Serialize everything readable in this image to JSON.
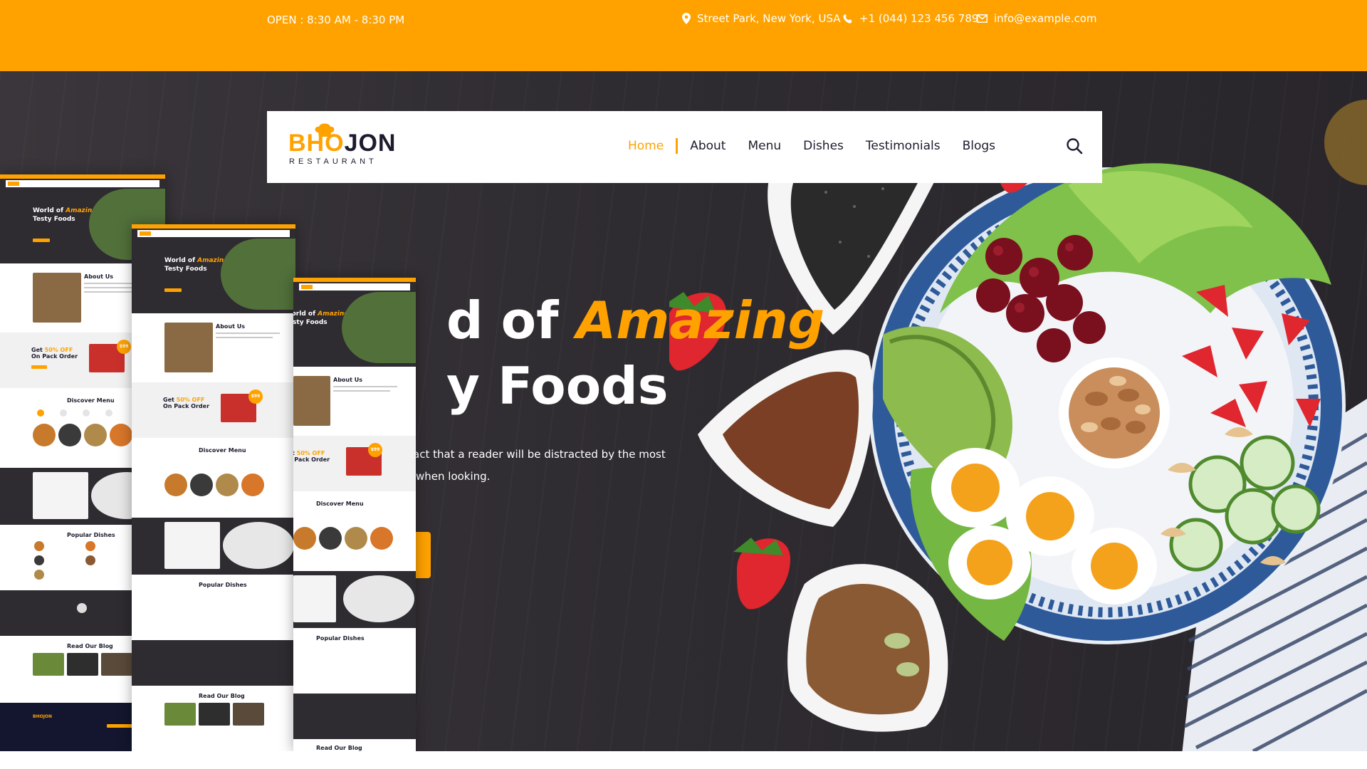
{
  "topbar": {
    "hours": "OPEN : 8:30 AM - 8:30 PM",
    "address": "Street Park, New York, USA",
    "phone": "+1 (044) 123 456 789",
    "email": "info@example.com",
    "icons": [
      "location-pin-icon",
      "phone-icon",
      "mail-icon"
    ]
  },
  "brand": {
    "name_part1": "BHO",
    "name_part2": "JON",
    "tagline": "RESTAURANT",
    "icon": "chef-hat-icon"
  },
  "nav": {
    "items": [
      {
        "label": "Home",
        "active": true
      },
      {
        "label": "About"
      },
      {
        "label": "Menu"
      },
      {
        "label": "Dishes"
      },
      {
        "label": "Testimonials"
      },
      {
        "label": "Blogs"
      }
    ],
    "search_icon": "search-icon"
  },
  "hero": {
    "title_part1": "d of ",
    "title_accent": "Amazing",
    "title_line2": "y Foods",
    "desc_line1": "act that a reader will be distracted by the most",
    "desc_line2": "when looking."
  },
  "previews": {
    "hero_title": "World of",
    "hero_accent": "Amazing",
    "hero_title2": "Testy Foods",
    "about": "About Us",
    "offer_prefix": "Get",
    "offer_pct": "50% OFF",
    "offer_line2": "On Pack Order",
    "price_badge": "$99",
    "discover": "Discover Menu",
    "popular": "Popular Dishes",
    "blog": "Read Our Blog",
    "footer_logo": "BHOJON"
  },
  "colors": {
    "brand": "#ffa200",
    "dark": "#2e2b31",
    "navy": "#13162e",
    "text": "#1c1c2e"
  }
}
